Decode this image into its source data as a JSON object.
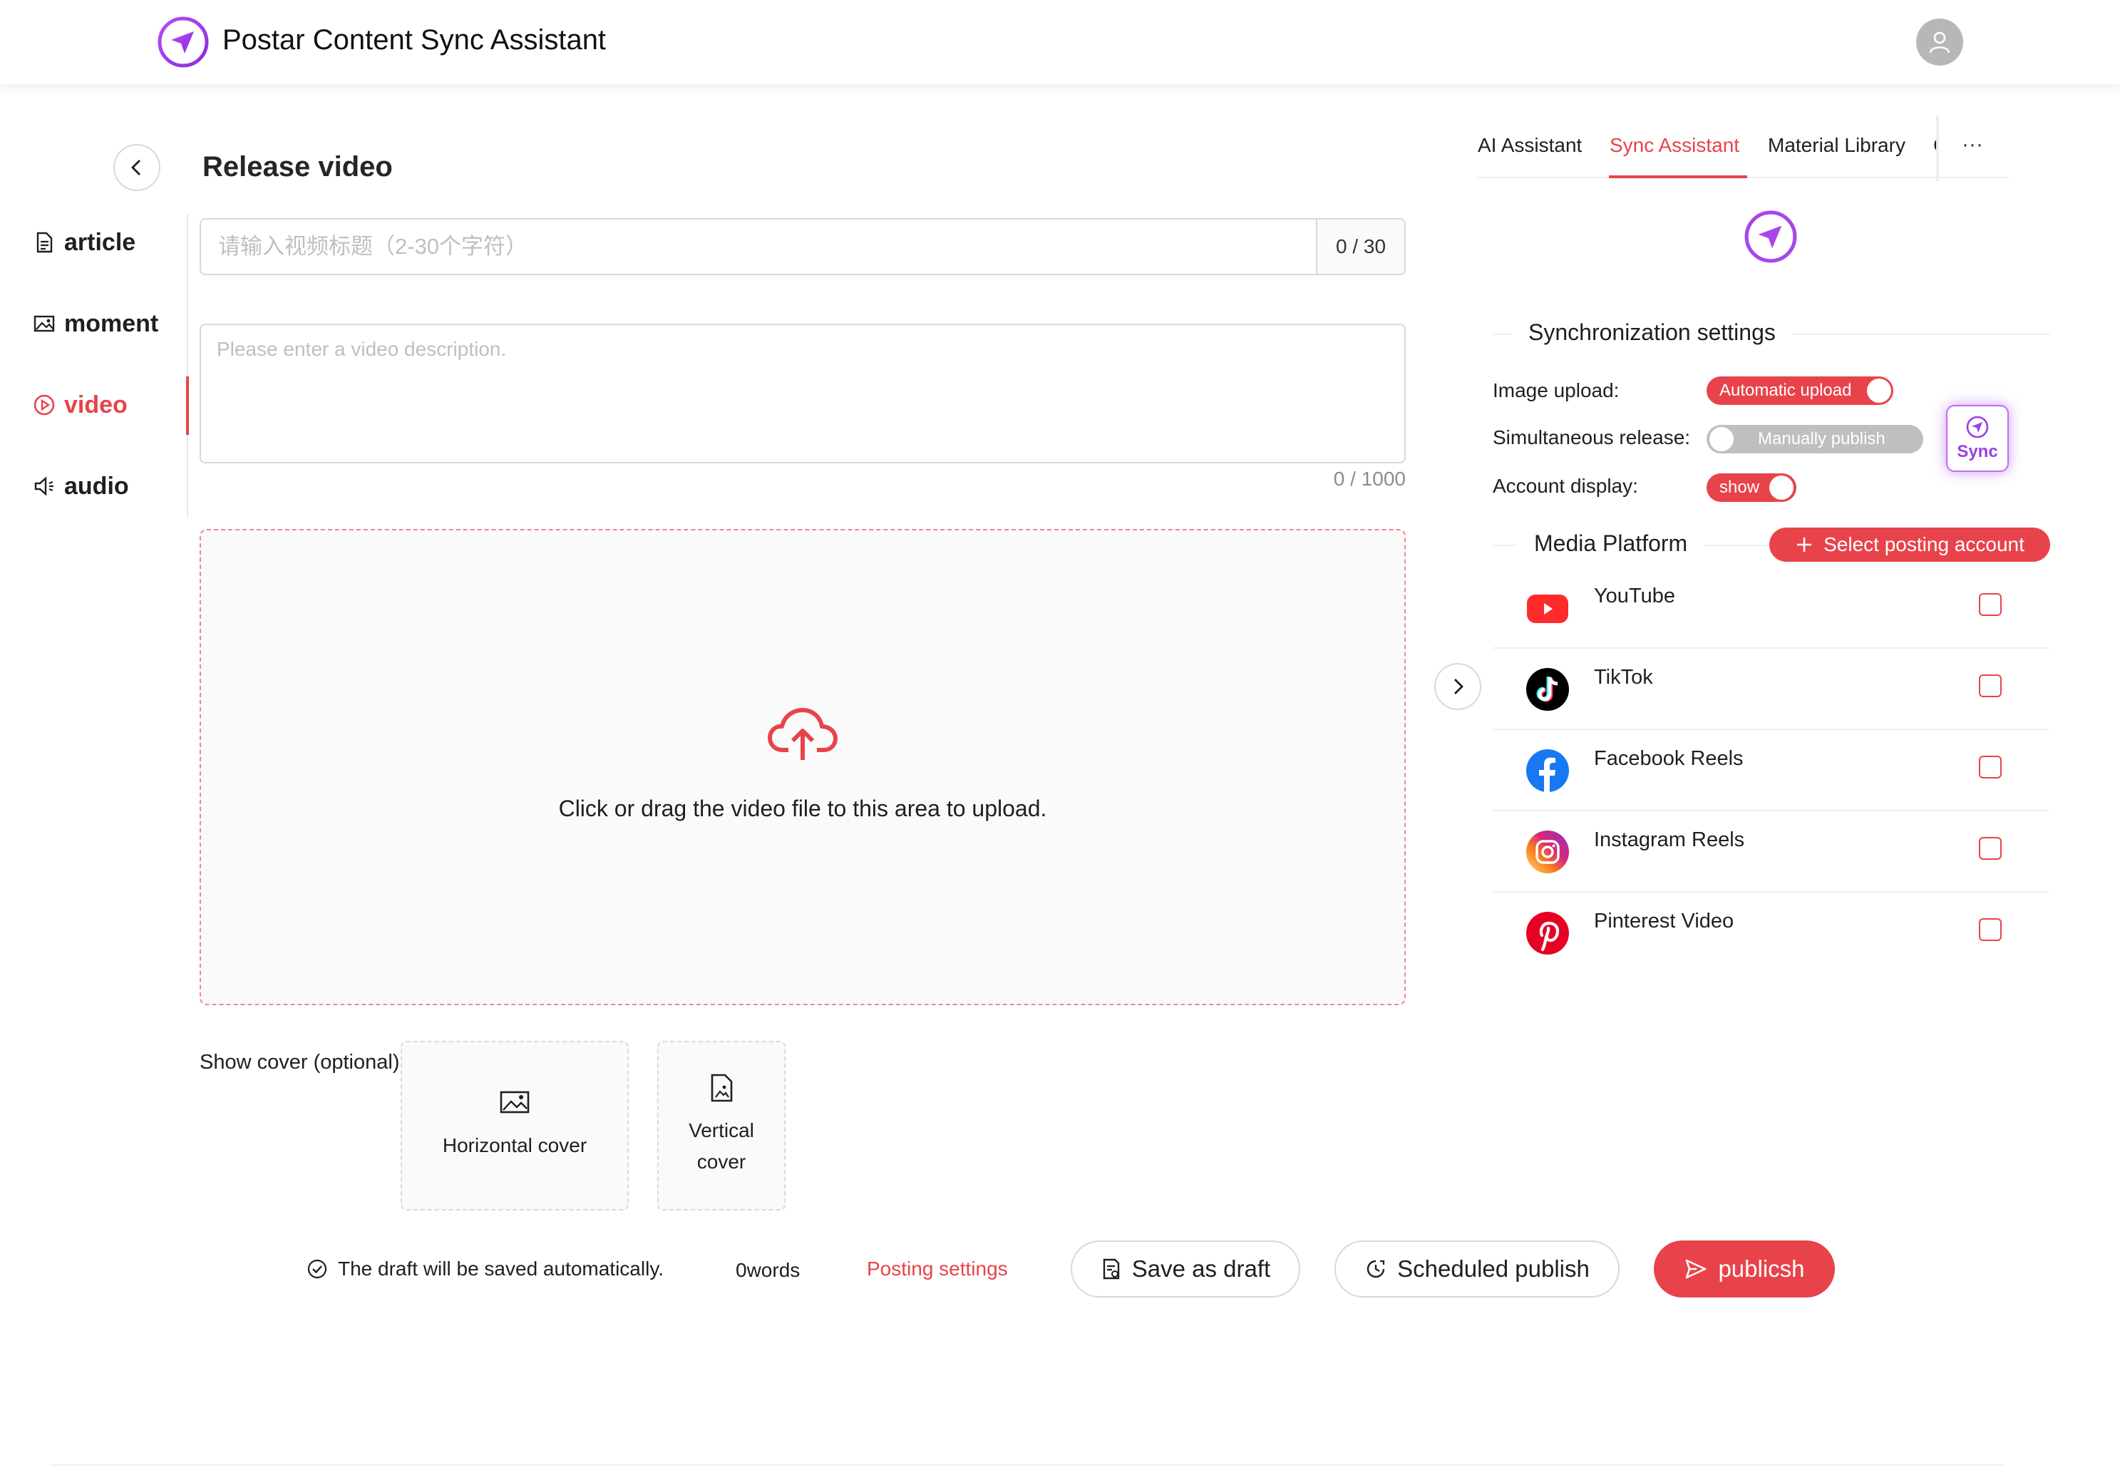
{
  "header": {
    "app_title": "Postar Content Sync Assistant",
    "logo_icon": "paper-plane-icon",
    "avatar_icon": "user-icon"
  },
  "page": {
    "title": "Release video",
    "back_icon": "chevron-left-icon"
  },
  "sidebar": {
    "items": [
      {
        "label": "article",
        "icon": "document-icon",
        "active": false
      },
      {
        "label": "moment",
        "icon": "image-icon",
        "active": false
      },
      {
        "label": "video",
        "icon": "play-circle-icon",
        "active": true
      },
      {
        "label": "audio",
        "icon": "speaker-icon",
        "active": false
      }
    ]
  },
  "form": {
    "title_placeholder": "请输入视频标题（2-30个字符）",
    "title_value": "",
    "title_count": "0 / 30",
    "desc_placeholder": "Please enter a video description.",
    "desc_value": "",
    "desc_count": "0 / 1000",
    "upload_text": "Click or drag the video file to this area to upload.",
    "cover_label": "Show cover (optional)",
    "cover_horizontal": "Horizontal cover",
    "cover_vertical_line1": "Vertical",
    "cover_vertical_line2": "cover"
  },
  "footer": {
    "auto_save": "The draft will be saved automatically.",
    "word_count": "0words",
    "posting_settings": "Posting settings",
    "save_draft": "Save as draft",
    "scheduled": "Scheduled publish",
    "publish": "publicsh"
  },
  "right_panel": {
    "tabs": [
      {
        "label": "AI Assistant",
        "active": false
      },
      {
        "label": "Sync Assistant",
        "active": true
      },
      {
        "label": "Material Library",
        "active": false
      }
    ],
    "tab_partial": "C",
    "more_label": "···",
    "sync_settings_title": "Synchronization settings",
    "settings": [
      {
        "label": "Image upload:",
        "switch_label": "Automatic upload",
        "on": true
      },
      {
        "label": "Simultaneous release:",
        "switch_label": "Manually publish",
        "on": false
      },
      {
        "label": "Account display:",
        "switch_label": "show",
        "on": true
      }
    ],
    "sync_button": "Sync",
    "media_platform_title": "Media Platform",
    "select_account": "Select posting account",
    "platforms": [
      {
        "name": "YouTube",
        "icon": "youtube-icon",
        "checked": false
      },
      {
        "name": "TikTok",
        "icon": "tiktok-icon",
        "checked": false
      },
      {
        "name": "Facebook Reels",
        "icon": "facebook-icon",
        "checked": false
      },
      {
        "name": "Instagram Reels",
        "icon": "instagram-icon",
        "checked": false
      },
      {
        "name": "Pinterest Video",
        "icon": "pinterest-icon",
        "checked": false
      }
    ]
  },
  "colors": {
    "accent": "#e8434b",
    "purple": "#9b3fe0"
  }
}
